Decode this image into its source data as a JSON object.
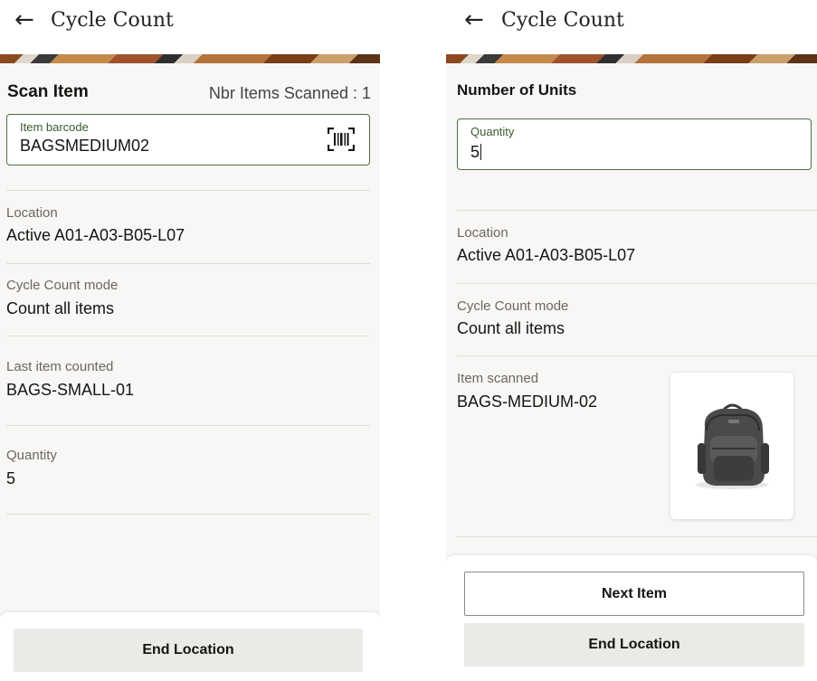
{
  "left": {
    "header": {
      "title": "Cycle Count"
    },
    "scan": {
      "title": "Scan Item",
      "count_text": "Nbr Items Scanned : 1"
    },
    "barcode_field": {
      "label": "Item barcode",
      "value": "BAGSMEDIUM02"
    },
    "details": [
      {
        "label": "Location",
        "value": "Active A01-A03-B05-L07"
      },
      {
        "label": "Cycle Count mode",
        "value": "Count all items"
      },
      {
        "label": "Last item counted",
        "value": "BAGS-SMALL-01"
      },
      {
        "label": "Quantity",
        "value": "5"
      }
    ],
    "footer": {
      "end_location_label": "End Location"
    }
  },
  "right": {
    "header": {
      "title": "Cycle Count"
    },
    "units": {
      "title": "Number of Units"
    },
    "quantity_field": {
      "label": "Quantity",
      "value": "5"
    },
    "details": [
      {
        "label": "Location",
        "value": "Active A01-A03-B05-L07"
      },
      {
        "label": "Cycle Count mode",
        "value": "Count all items"
      },
      {
        "label": "Item scanned",
        "value": "BAGS-MEDIUM-02"
      }
    ],
    "footer": {
      "next_item_label": "Next Item",
      "end_location_label": "End Location"
    }
  },
  "icons": {
    "back": "arrow-left-icon",
    "barcode": "barcode-scan-icon",
    "product": "backpack-image"
  },
  "colors": {
    "field_border": "#4e6e41",
    "background": "#f8f7f5",
    "button_grey": "#ebeae7"
  }
}
